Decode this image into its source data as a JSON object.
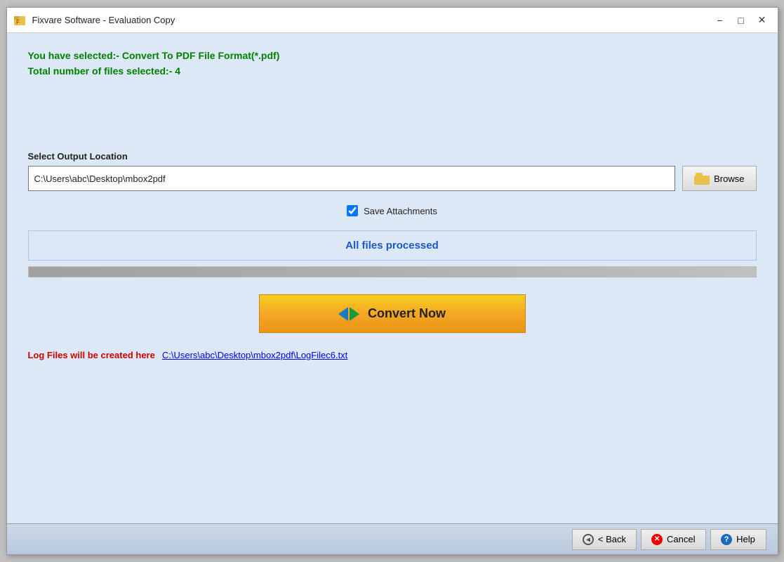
{
  "window": {
    "title": "Fixvare Software - Evaluation Copy"
  },
  "info": {
    "line1": "You have selected:- Convert To PDF File Format(*.pdf)",
    "line2": "Total number of files selected:- 4"
  },
  "output": {
    "label": "Select Output Location",
    "path": "C:\\Users\\abc\\Desktop\\mbox2pdf",
    "browse_label": "Browse"
  },
  "checkbox": {
    "label": "Save Attachments",
    "checked": true
  },
  "status": {
    "text": "All files processed"
  },
  "convert_button": {
    "label": "Convert Now"
  },
  "log": {
    "label": "Log Files will be created here",
    "link_text": "C:\\Users\\abc\\Desktop\\mbox2pdf\\LogFilec6.txt"
  },
  "bottom_buttons": {
    "back": "< Back",
    "cancel": "Cancel",
    "help": "Help"
  }
}
